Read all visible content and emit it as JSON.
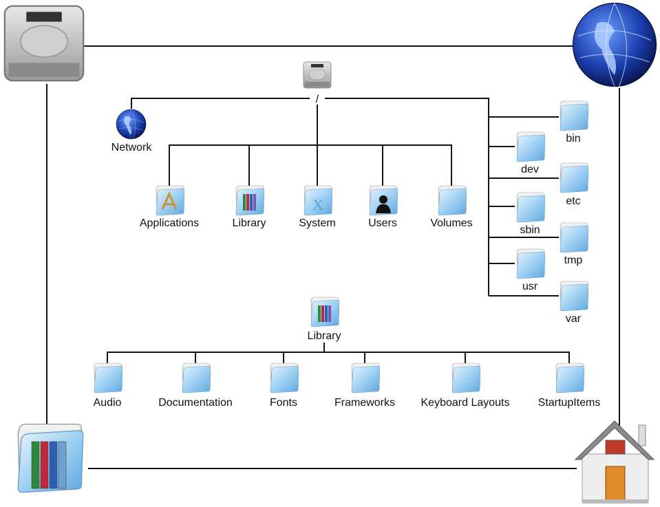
{
  "root": {
    "label": "/",
    "icon": "hard-drive-icon"
  },
  "network": {
    "label": "Network",
    "icon": "globe-icon"
  },
  "top_level": [
    {
      "label": "Applications",
      "icon": "applications-folder-icon"
    },
    {
      "label": "Library",
      "icon": "library-folder-icon"
    },
    {
      "label": "System",
      "icon": "system-folder-icon"
    },
    {
      "label": "Users",
      "icon": "users-folder-icon"
    },
    {
      "label": "Volumes",
      "icon": "folder-icon"
    }
  ],
  "unix_dirs": [
    {
      "label": "bin"
    },
    {
      "label": "dev"
    },
    {
      "label": "etc"
    },
    {
      "label": "sbin"
    },
    {
      "label": "tmp"
    },
    {
      "label": "usr"
    },
    {
      "label": "var"
    }
  ],
  "library": {
    "label": "Library",
    "icon": "library-folder-icon"
  },
  "library_children": [
    {
      "label": "Audio"
    },
    {
      "label": "Documentation"
    },
    {
      "label": "Fonts"
    },
    {
      "label": "Frameworks"
    },
    {
      "label": "Keyboard Layouts"
    },
    {
      "label": "StartupItems"
    }
  ],
  "corners": {
    "top_left": "hard-drive-icon",
    "top_right": "globe-icon",
    "bottom_left": "library-folder-icon",
    "bottom_right": "home-icon"
  }
}
